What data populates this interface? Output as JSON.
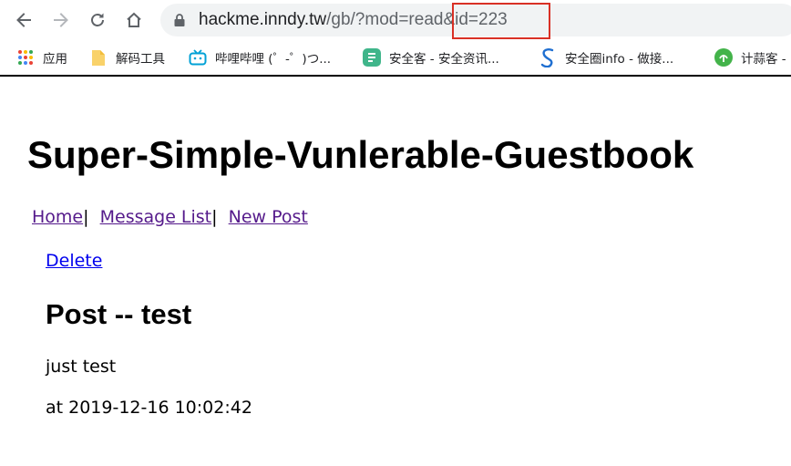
{
  "browser": {
    "url_host": "hackme.inndy.tw",
    "url_path": "/gb/?mod=read&id=223",
    "highlight_color": "#d93025"
  },
  "bookmarks": [
    {
      "label": "应用",
      "icon": "apps-grid-icon"
    },
    {
      "label": "解码工具",
      "icon": "folder-icon"
    },
    {
      "label": "哔哩哔哩 (゜-゜)つ...",
      "icon": "bilibili-icon"
    },
    {
      "label": "安全客 - 安全资讯...",
      "icon": "anquanke-icon"
    },
    {
      "label": "安全圈info - 做接...",
      "icon": "anquanquan-icon"
    },
    {
      "label": "计蒜客 -",
      "icon": "jisuanke-icon"
    }
  ],
  "page": {
    "title": "Super-Simple-Vunlerable-Guestbook",
    "nav": {
      "home": "Home",
      "message_list": "Message List",
      "new_post": "New Post",
      "separator": "|"
    },
    "delete_label": "Delete",
    "post": {
      "title": "Post -- test",
      "body": "just test",
      "date": "at 2019-12-16 10:02:42"
    }
  }
}
